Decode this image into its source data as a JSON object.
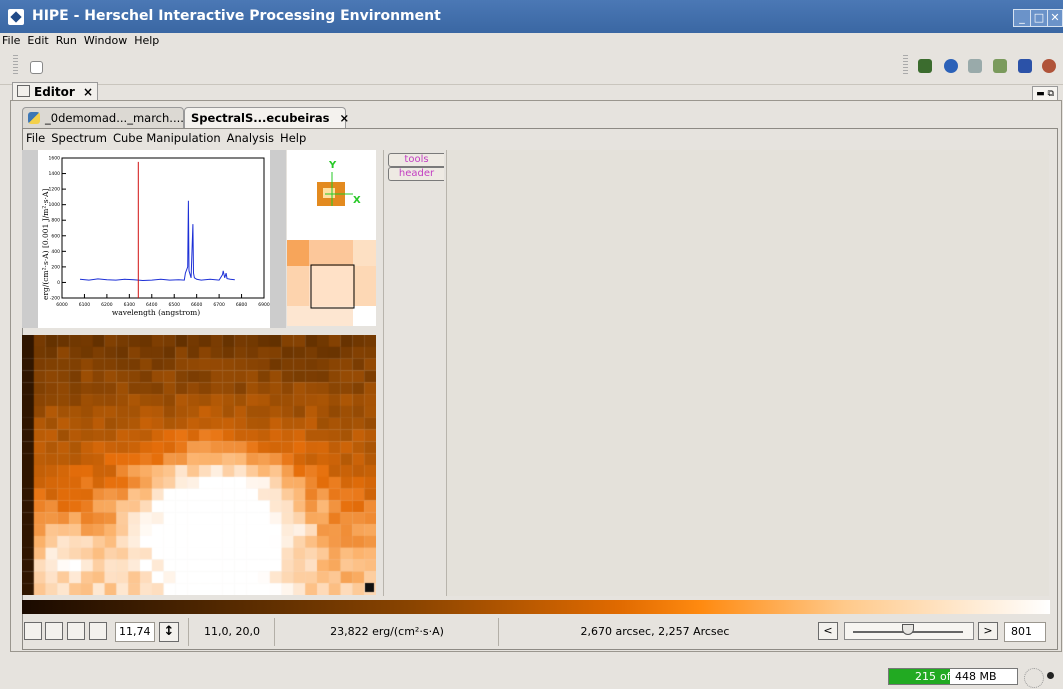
{
  "window": {
    "title": "HIPE - Herschel Interactive Processing Environment"
  },
  "menu": [
    "File",
    "Edit",
    "Run",
    "Window",
    "Help"
  ],
  "perspective": {
    "editor_tab": "Editor",
    "close": "×"
  },
  "doc_tabs": [
    {
      "label": "_0demomad..._march...."
    },
    {
      "label": "SpectralS...ecubeiras",
      "close": "×"
    }
  ],
  "cube_menu": [
    "File",
    "Spectrum",
    "Cube Manipulation",
    "Analysis",
    "Help"
  ],
  "side_tabs": {
    "tools": "tools",
    "header": "header"
  },
  "spectrum_plot": {
    "xlabel": "wavelength (angstrom)",
    "ylabel": "erg/(cm²·s·A) [0.001 J/m²·s·A]"
  },
  "chart_data": {
    "type": "line",
    "title": "",
    "xlabel": "wavelength (angstrom)",
    "ylabel": "erg/(cm²·s·A) [0.001 J/m²·s·A]",
    "xlim": [
      6000,
      6900
    ],
    "ylim": [
      -200,
      1600
    ],
    "x_ticks": [
      "6000",
      "6100",
      "6200",
      "6300",
      "6400",
      "6500",
      "6600",
      "6700",
      "6800",
      "6900"
    ],
    "y_ticks": [
      "-200",
      "0",
      "200",
      "400",
      "600",
      "800",
      "1000",
      "1200",
      "1400",
      "1600"
    ],
    "grid": false,
    "series": [
      {
        "color": "#1c2fd6",
        "x": [
          6080,
          6120,
          6160,
          6200,
          6240,
          6280,
          6320,
          6360,
          6400,
          6440,
          6480,
          6520,
          6545,
          6550,
          6560,
          6563,
          6566,
          6575,
          6583,
          6586,
          6590,
          6600,
          6620,
          6660,
          6700,
          6715,
          6718,
          6725,
          6731,
          6735,
          6750,
          6770
        ],
        "y": [
          40,
          30,
          45,
          35,
          30,
          40,
          35,
          25,
          30,
          40,
          30,
          35,
          30,
          120,
          200,
          1050,
          150,
          60,
          750,
          120,
          60,
          40,
          30,
          40,
          30,
          100,
          150,
          60,
          120,
          50,
          40,
          35
        ]
      },
      {
        "color": "#d01010",
        "x": [
          6340,
          6340
        ],
        "y": [
          -200,
          1550
        ]
      }
    ]
  },
  "minimap": {
    "axis_y": "Y",
    "axis_x": "X"
  },
  "status": {
    "zoom_value": "11,74",
    "pixel_coords": "11,0, 20,0",
    "flux_value": "23,822 erg/(cm²·s·A)",
    "sky_coords": "2,670 arcsec, 2,257 Arcsec",
    "prev": "<",
    "next": ">",
    "slice_value": "801",
    "slider_fraction": 0.5
  },
  "memory": {
    "used": "215",
    "of": "of",
    "total": "448 MB",
    "used_fraction": 0.48
  },
  "colors": {
    "title_bar": "#3f6cab",
    "memory_green": "#22aa22"
  }
}
